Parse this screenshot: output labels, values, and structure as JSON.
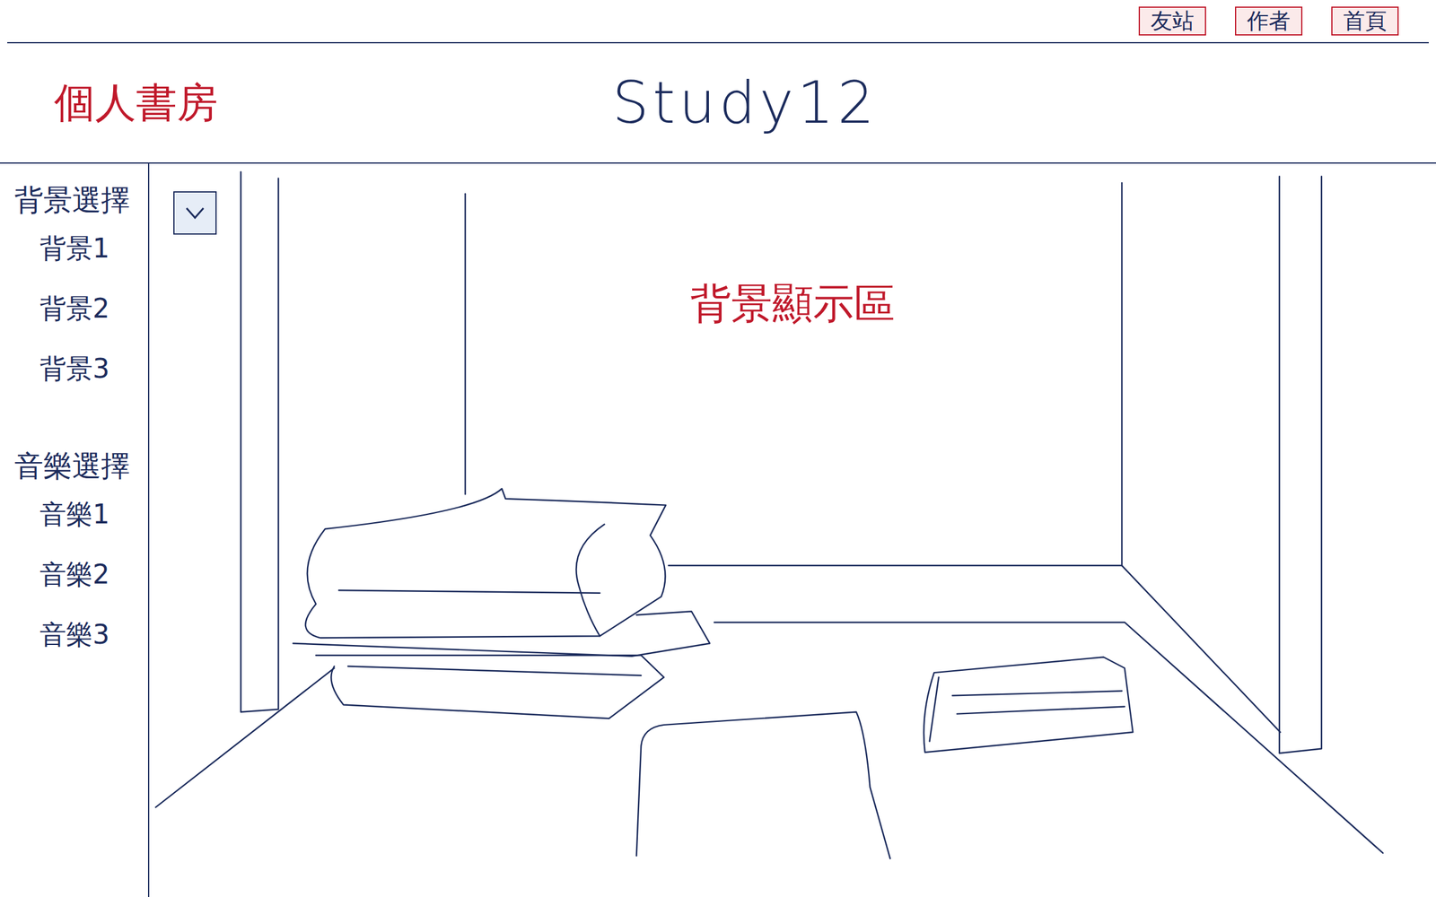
{
  "site": {
    "title": "個人書房",
    "logo": "Study12"
  },
  "nav": [
    {
      "label": "友站"
    },
    {
      "label": "作者"
    },
    {
      "label": "首頁"
    }
  ],
  "sidebar": {
    "sections": [
      {
        "title": "背景選擇",
        "items": [
          "背景1",
          "背景2",
          "背景3"
        ]
      },
      {
        "title": "音樂選擇",
        "items": [
          "音樂1",
          "音樂2",
          "音樂3"
        ]
      }
    ]
  },
  "dropdown": {
    "expanded": false
  },
  "main": {
    "label": "背景顯示區"
  }
}
